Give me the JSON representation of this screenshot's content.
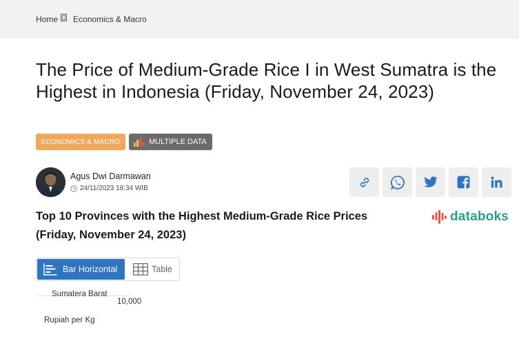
{
  "breadcrumb": {
    "home": "Home",
    "category": "Economics & Macro"
  },
  "article": {
    "title": "The Price of Medium-Grade Rice I in West Sumatra is the Highest in Indonesia (Friday, November 24, 2023)",
    "tags": {
      "category": "ECONOMICS & MACRO",
      "data_type": "MULTIPLE DATA"
    },
    "author": "Agus Dwi Darmawan",
    "datetime": "24/11/2023 18:34 WIB"
  },
  "share": {
    "icons": [
      "link-icon",
      "whatsapp-icon",
      "twitter-icon",
      "facebook-icon",
      "linkedin-icon"
    ]
  },
  "chart_section": {
    "title": "Top 10 Provinces with the Highest Medium-Grade Rice Prices (Friday, November 24, 2023)",
    "brand": "databoks",
    "view_options": {
      "bar": "Bar Horizontal",
      "table": "Table"
    }
  },
  "chart_data": {
    "type": "bar",
    "categories": [
      "Sumatera Barat"
    ],
    "values": [],
    "xlabel": "",
    "ylabel": "Rupiah per Kg",
    "tick_labels": [
      "10,000"
    ]
  },
  "colors": {
    "accent": "#2f74c0",
    "tag_category": "#f0a85c",
    "tag_multi": "#6b6b6b",
    "brand": "#2a9d8f"
  }
}
